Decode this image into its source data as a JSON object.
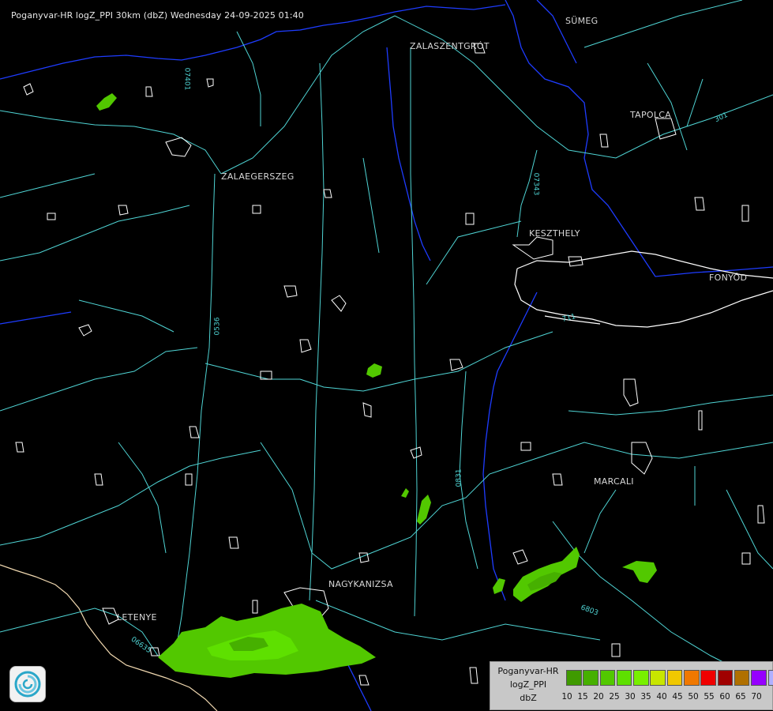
{
  "title": "Poganyvar-HR logZ_PPI 30km (dbZ) Wednesday 24-09-2025 01:40",
  "cities": [
    {
      "name": "SÜMEG"
    },
    {
      "name": "ZALASZENTGRÓT"
    },
    {
      "name": "TAPOLCA"
    },
    {
      "name": "ZALAEGERSZEG"
    },
    {
      "name": "KESZTHELY"
    },
    {
      "name": "FONYÓD"
    },
    {
      "name": "MARCALI"
    },
    {
      "name": "NAGYKANIZSA"
    },
    {
      "name": "LETENYE"
    }
  ],
  "road_labels": [
    "07401",
    "07343",
    "0536",
    "0831",
    "6803",
    "06635",
    "301",
    "711"
  ],
  "legend": {
    "line1": "Poganyvar-HR",
    "line2": "logZ_PPI",
    "line3": "dbZ",
    "levels": [
      {
        "value": "10",
        "color": "#3f9a00"
      },
      {
        "value": "15",
        "color": "#46b000"
      },
      {
        "value": "20",
        "color": "#52c800"
      },
      {
        "value": "25",
        "color": "#5ee000"
      },
      {
        "value": "30",
        "color": "#78f000"
      },
      {
        "value": "35",
        "color": "#c8e600"
      },
      {
        "value": "40",
        "color": "#f0c800"
      },
      {
        "value": "45",
        "color": "#f07800"
      },
      {
        "value": "50",
        "color": "#f00000"
      },
      {
        "value": "55",
        "color": "#a00000"
      },
      {
        "value": "60",
        "color": "#b07000"
      },
      {
        "value": "65",
        "color": "#9600ff"
      },
      {
        "value": "70",
        "color": "#b0b0ff"
      }
    ]
  },
  "colors": {
    "background": "#000000",
    "roads": "#4fd4d4",
    "rivers": "#1e3cff",
    "boundaries": "#ffffff",
    "border": "#f0d8b0"
  }
}
